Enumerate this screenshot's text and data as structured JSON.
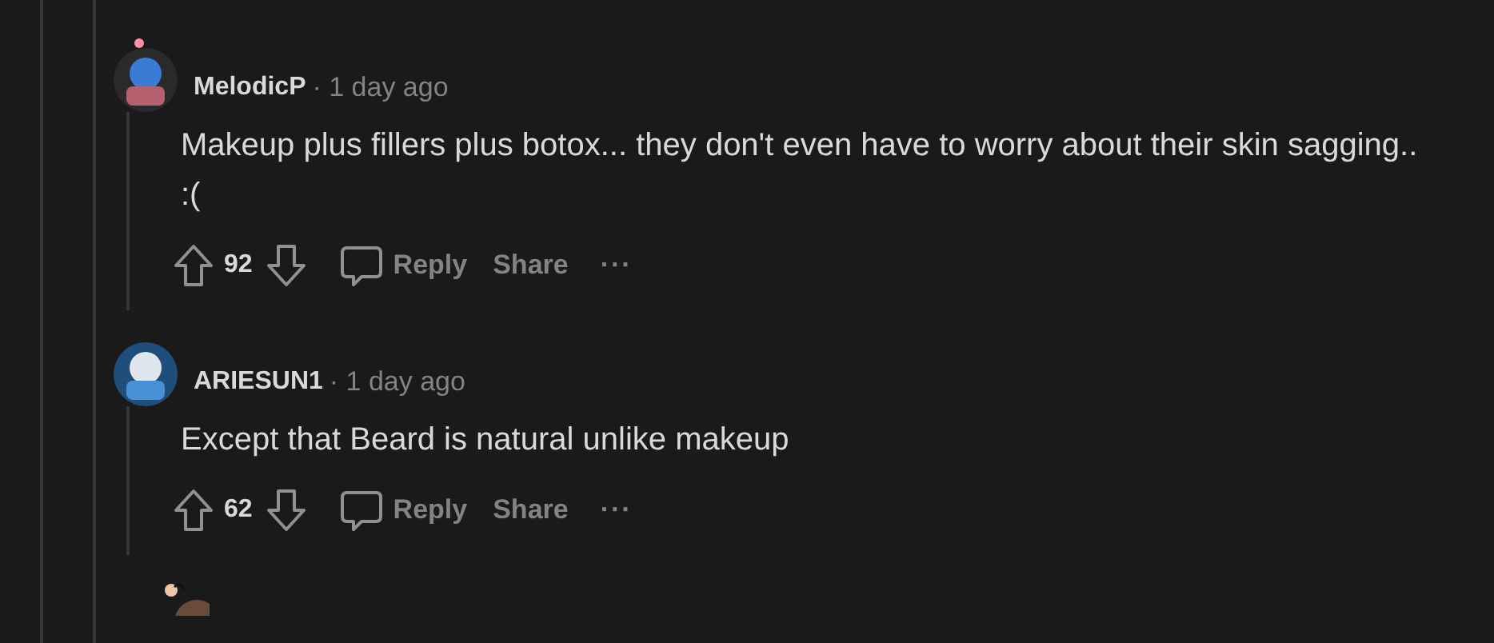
{
  "comments": [
    {
      "author": "MelodicP",
      "time": "· 1 day ago",
      "body": "Makeup plus fillers plus botox... they don't even have to worry about their skin sagging.. :(",
      "score": "92",
      "reply": "Reply",
      "share": "Share",
      "more": "···"
    },
    {
      "author": "ARIESUN1",
      "time": "· 1 day ago",
      "body": "Except that Beard is natural unlike makeup",
      "score": "62",
      "reply": "Reply",
      "share": "Share",
      "more": "···"
    }
  ]
}
